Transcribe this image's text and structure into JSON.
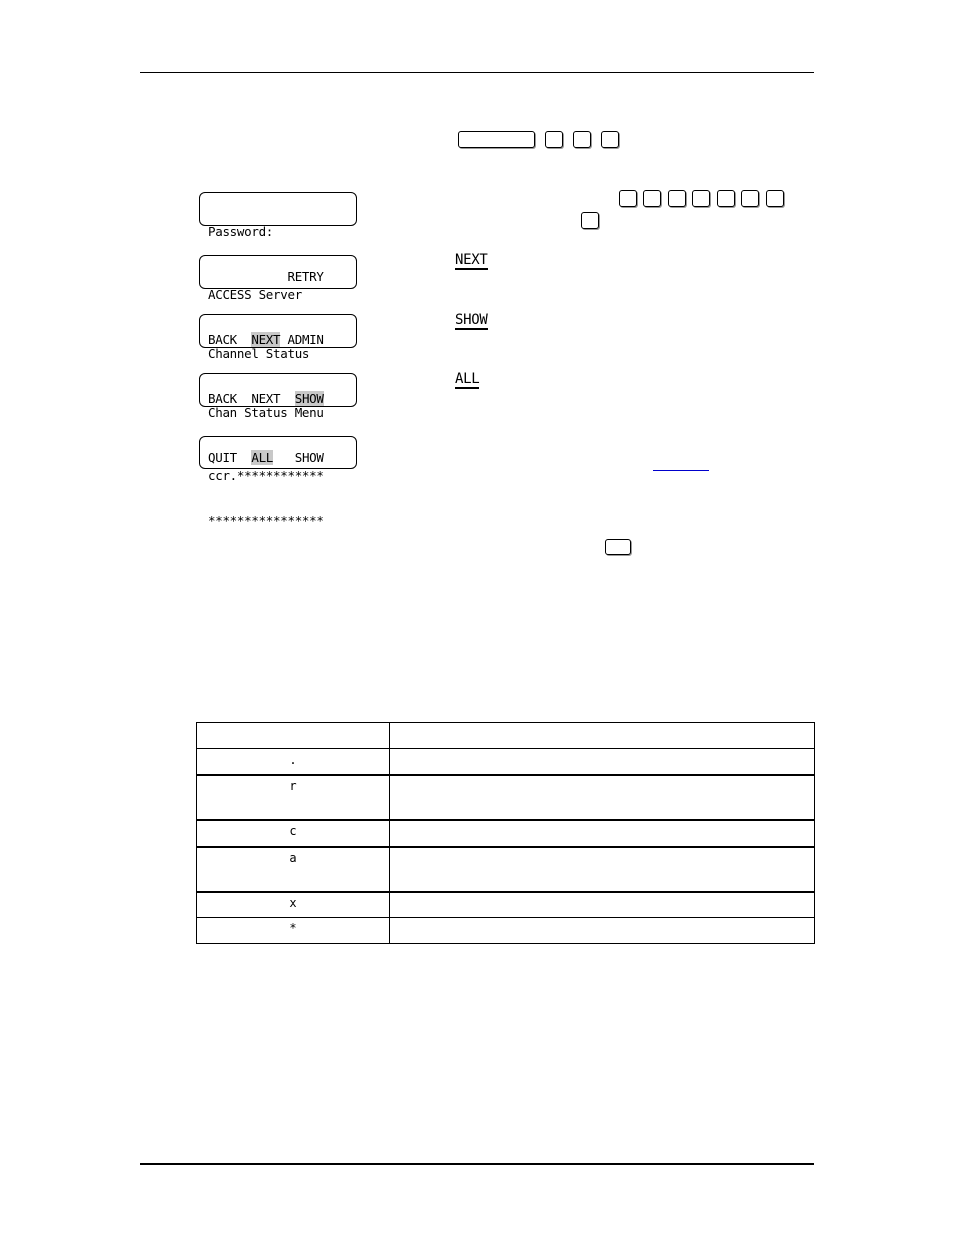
{
  "lcd_screens": [
    {
      "line1": "Password:",
      "line2_pre": "           ",
      "line2_hl": "",
      "line2_post": "RETRY"
    },
    {
      "line1": "ACCESS Server",
      "line2_pre": "BACK  ",
      "line2_hl": "NEXT",
      "line2_post": " ADMIN"
    },
    {
      "line1": "Channel Status",
      "line2_pre": "BACK  NEXT  ",
      "line2_hl": "SHOW",
      "line2_post": ""
    },
    {
      "line1": "Chan Status Menu",
      "line2_pre": "QUIT  ",
      "line2_hl": "ALL",
      "line2_post": "   SHOW"
    },
    {
      "line1": "ccr.************",
      "line2_pre": "****************",
      "line2_hl": "",
      "line2_post": ""
    }
  ],
  "softkeys": [
    "NEXT",
    "SHOW",
    "ALL"
  ],
  "status_table": {
    "header": [
      "",
      ""
    ],
    "rows": [
      {
        "code": ".",
        "desc": ""
      },
      {
        "code": "r",
        "desc": ""
      },
      {
        "code": "c",
        "desc": ""
      },
      {
        "code": "a",
        "desc": ""
      },
      {
        "code": "x",
        "desc": ""
      },
      {
        "code": "*",
        "desc": ""
      }
    ]
  },
  "colors": {
    "highlight": "#c8c8c8",
    "link": "#0000cc"
  }
}
